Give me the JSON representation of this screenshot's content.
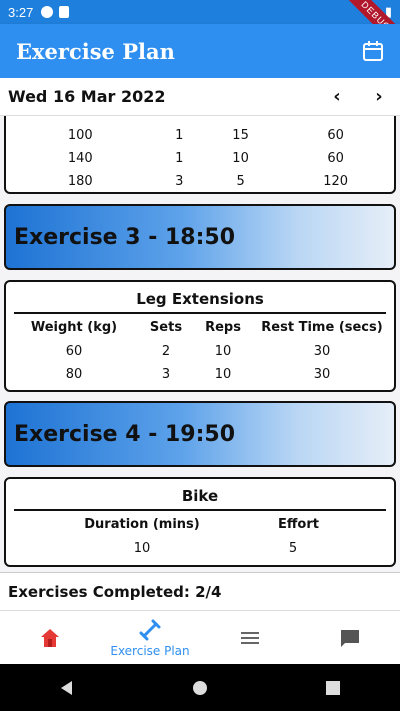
{
  "status_bar": {
    "time": "3:27",
    "debug_label": "DEBUG"
  },
  "app_bar": {
    "title": "Exercise Plan",
    "action_icon": "calendar-icon"
  },
  "date_bar": {
    "date": "Wed 16 Mar 2022",
    "prev_icon": "chevron-left-icon",
    "next_icon": "chevron-right-icon"
  },
  "card_top": {
    "rows": [
      [
        "100",
        "1",
        "15",
        "60"
      ],
      [
        "140",
        "1",
        "10",
        "60"
      ],
      [
        "180",
        "3",
        "5",
        "120"
      ]
    ]
  },
  "exercise3": {
    "banner": "Exercise 3 - 18:50",
    "name": "Leg Extensions",
    "headers": [
      "Weight (kg)",
      "Sets",
      "Reps",
      "Rest Time (secs)"
    ],
    "rows": [
      [
        "60",
        "2",
        "10",
        "30"
      ],
      [
        "80",
        "3",
        "10",
        "30"
      ]
    ]
  },
  "exercise4": {
    "banner": "Exercise 4 - 19:50",
    "name": "Bike",
    "headers": [
      "Duration (mins)",
      "Effort"
    ],
    "rows": [
      [
        "10",
        "5"
      ]
    ]
  },
  "summary": {
    "text": "Exercises Completed: 2/4"
  },
  "bottom_nav": {
    "items": [
      {
        "icon": "home-icon",
        "label": ""
      },
      {
        "icon": "dumbbell-icon",
        "label": "Exercise Plan",
        "active": true
      },
      {
        "icon": "menu-icon",
        "label": ""
      },
      {
        "icon": "chat-icon",
        "label": ""
      }
    ]
  },
  "colors": {
    "primary": "#2f8ff0",
    "status_bar": "#1f7fdc",
    "active_nav": "#2f8ff0",
    "home_icon": "#e53935"
  }
}
